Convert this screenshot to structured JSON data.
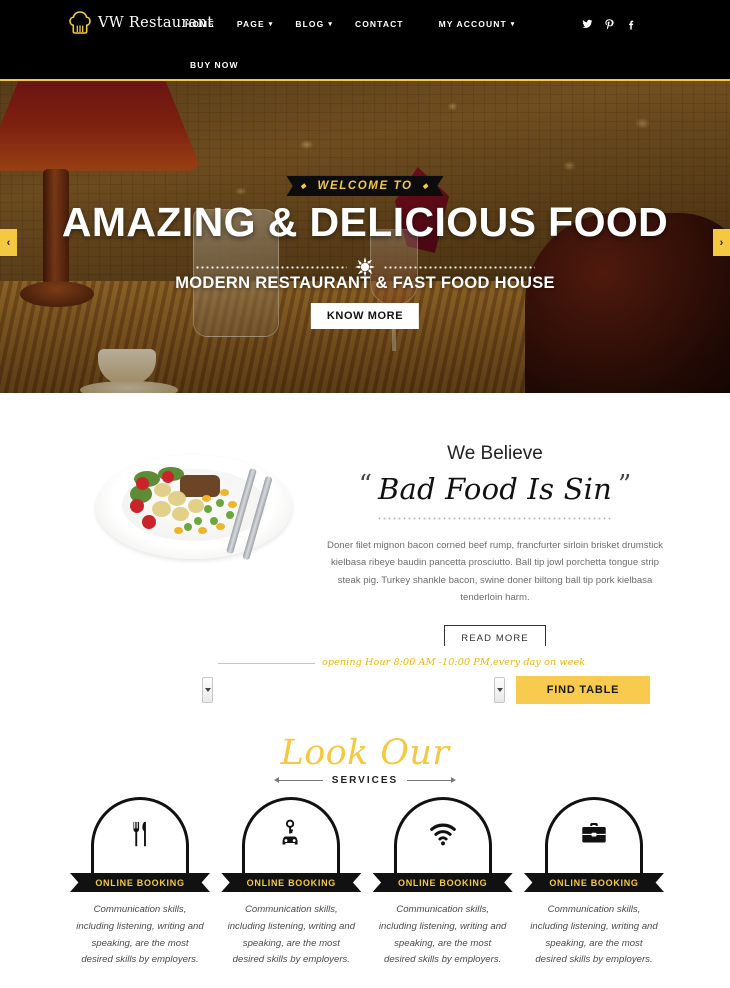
{
  "header": {
    "logo_text": "VW Restaurant",
    "logo_icon": "chef-hat-icon",
    "nav": [
      {
        "label": "HOME",
        "has_caret": false
      },
      {
        "label": "PAGE",
        "has_caret": true
      },
      {
        "label": "BLOG",
        "has_caret": true
      },
      {
        "label": "CONTACT",
        "has_caret": false
      },
      {
        "label": "MY ACCOUNT",
        "has_caret": true
      }
    ],
    "nav_secondary": {
      "label": "BUY NOW"
    },
    "socials": [
      {
        "name": "twitter-icon"
      },
      {
        "name": "pinterest-icon"
      },
      {
        "name": "facebook-icon"
      }
    ],
    "bg_color": "#000000",
    "accent_color": "#f5c842"
  },
  "hero": {
    "ribbon": "WELCOME TO",
    "title": "AMAZING & DELICIOUS FOOD",
    "subtitle": "MODERN RESTAURANT & FAST FOOD HOUSE",
    "button": "KNOW MORE",
    "prev_arrow": "‹",
    "next_arrow": "›",
    "arrow_color": "#f5c842"
  },
  "believe": {
    "heading": "We Believe",
    "quote_open": "“",
    "quote": "Bad Food Is Sin",
    "quote_close": "”",
    "paragraph": "Doner filet mignon bacon corned beef rump, francfurter sirloin brisket drumstick kielbasa ribeye baudin pancetta prosciutto. Ball tip jowl porchetta tongue strip steak pig. Turkey shankle bacon, swine doner biltong ball tip pork kielbasa tenderloin harm.",
    "button": "READ MORE",
    "image_alt": "plate-of-food-image"
  },
  "booking": {
    "hours": "opening Hour 8:00 AM -10:00 PM,every day on week",
    "hours_color": "#f0b400",
    "find_table_button": "FIND TABLE",
    "button_color": "#f8ca4d"
  },
  "services": {
    "title": "Look Our",
    "subtitle": "SERVICES",
    "title_color": "#f5c842",
    "cards": [
      {
        "icon": "fork-knife-icon",
        "banner": "ONLINE BOOKING",
        "text": "Communication skills, including listening, writing and speaking, are the most desired skills by employers."
      },
      {
        "icon": "car-key-icon",
        "banner": "ONLINE BOOKING",
        "text": "Communication skills, including listening, writing and speaking, are the most desired skills by employers."
      },
      {
        "icon": "wifi-icon",
        "banner": "ONLINE BOOKING",
        "text": "Communication skills, including listening, writing and speaking, are the most desired skills by employers."
      },
      {
        "icon": "briefcase-icon",
        "banner": "ONLINE BOOKING",
        "text": "Communication skills, including listening, writing and speaking, are the most desired skills by employers."
      }
    ]
  }
}
